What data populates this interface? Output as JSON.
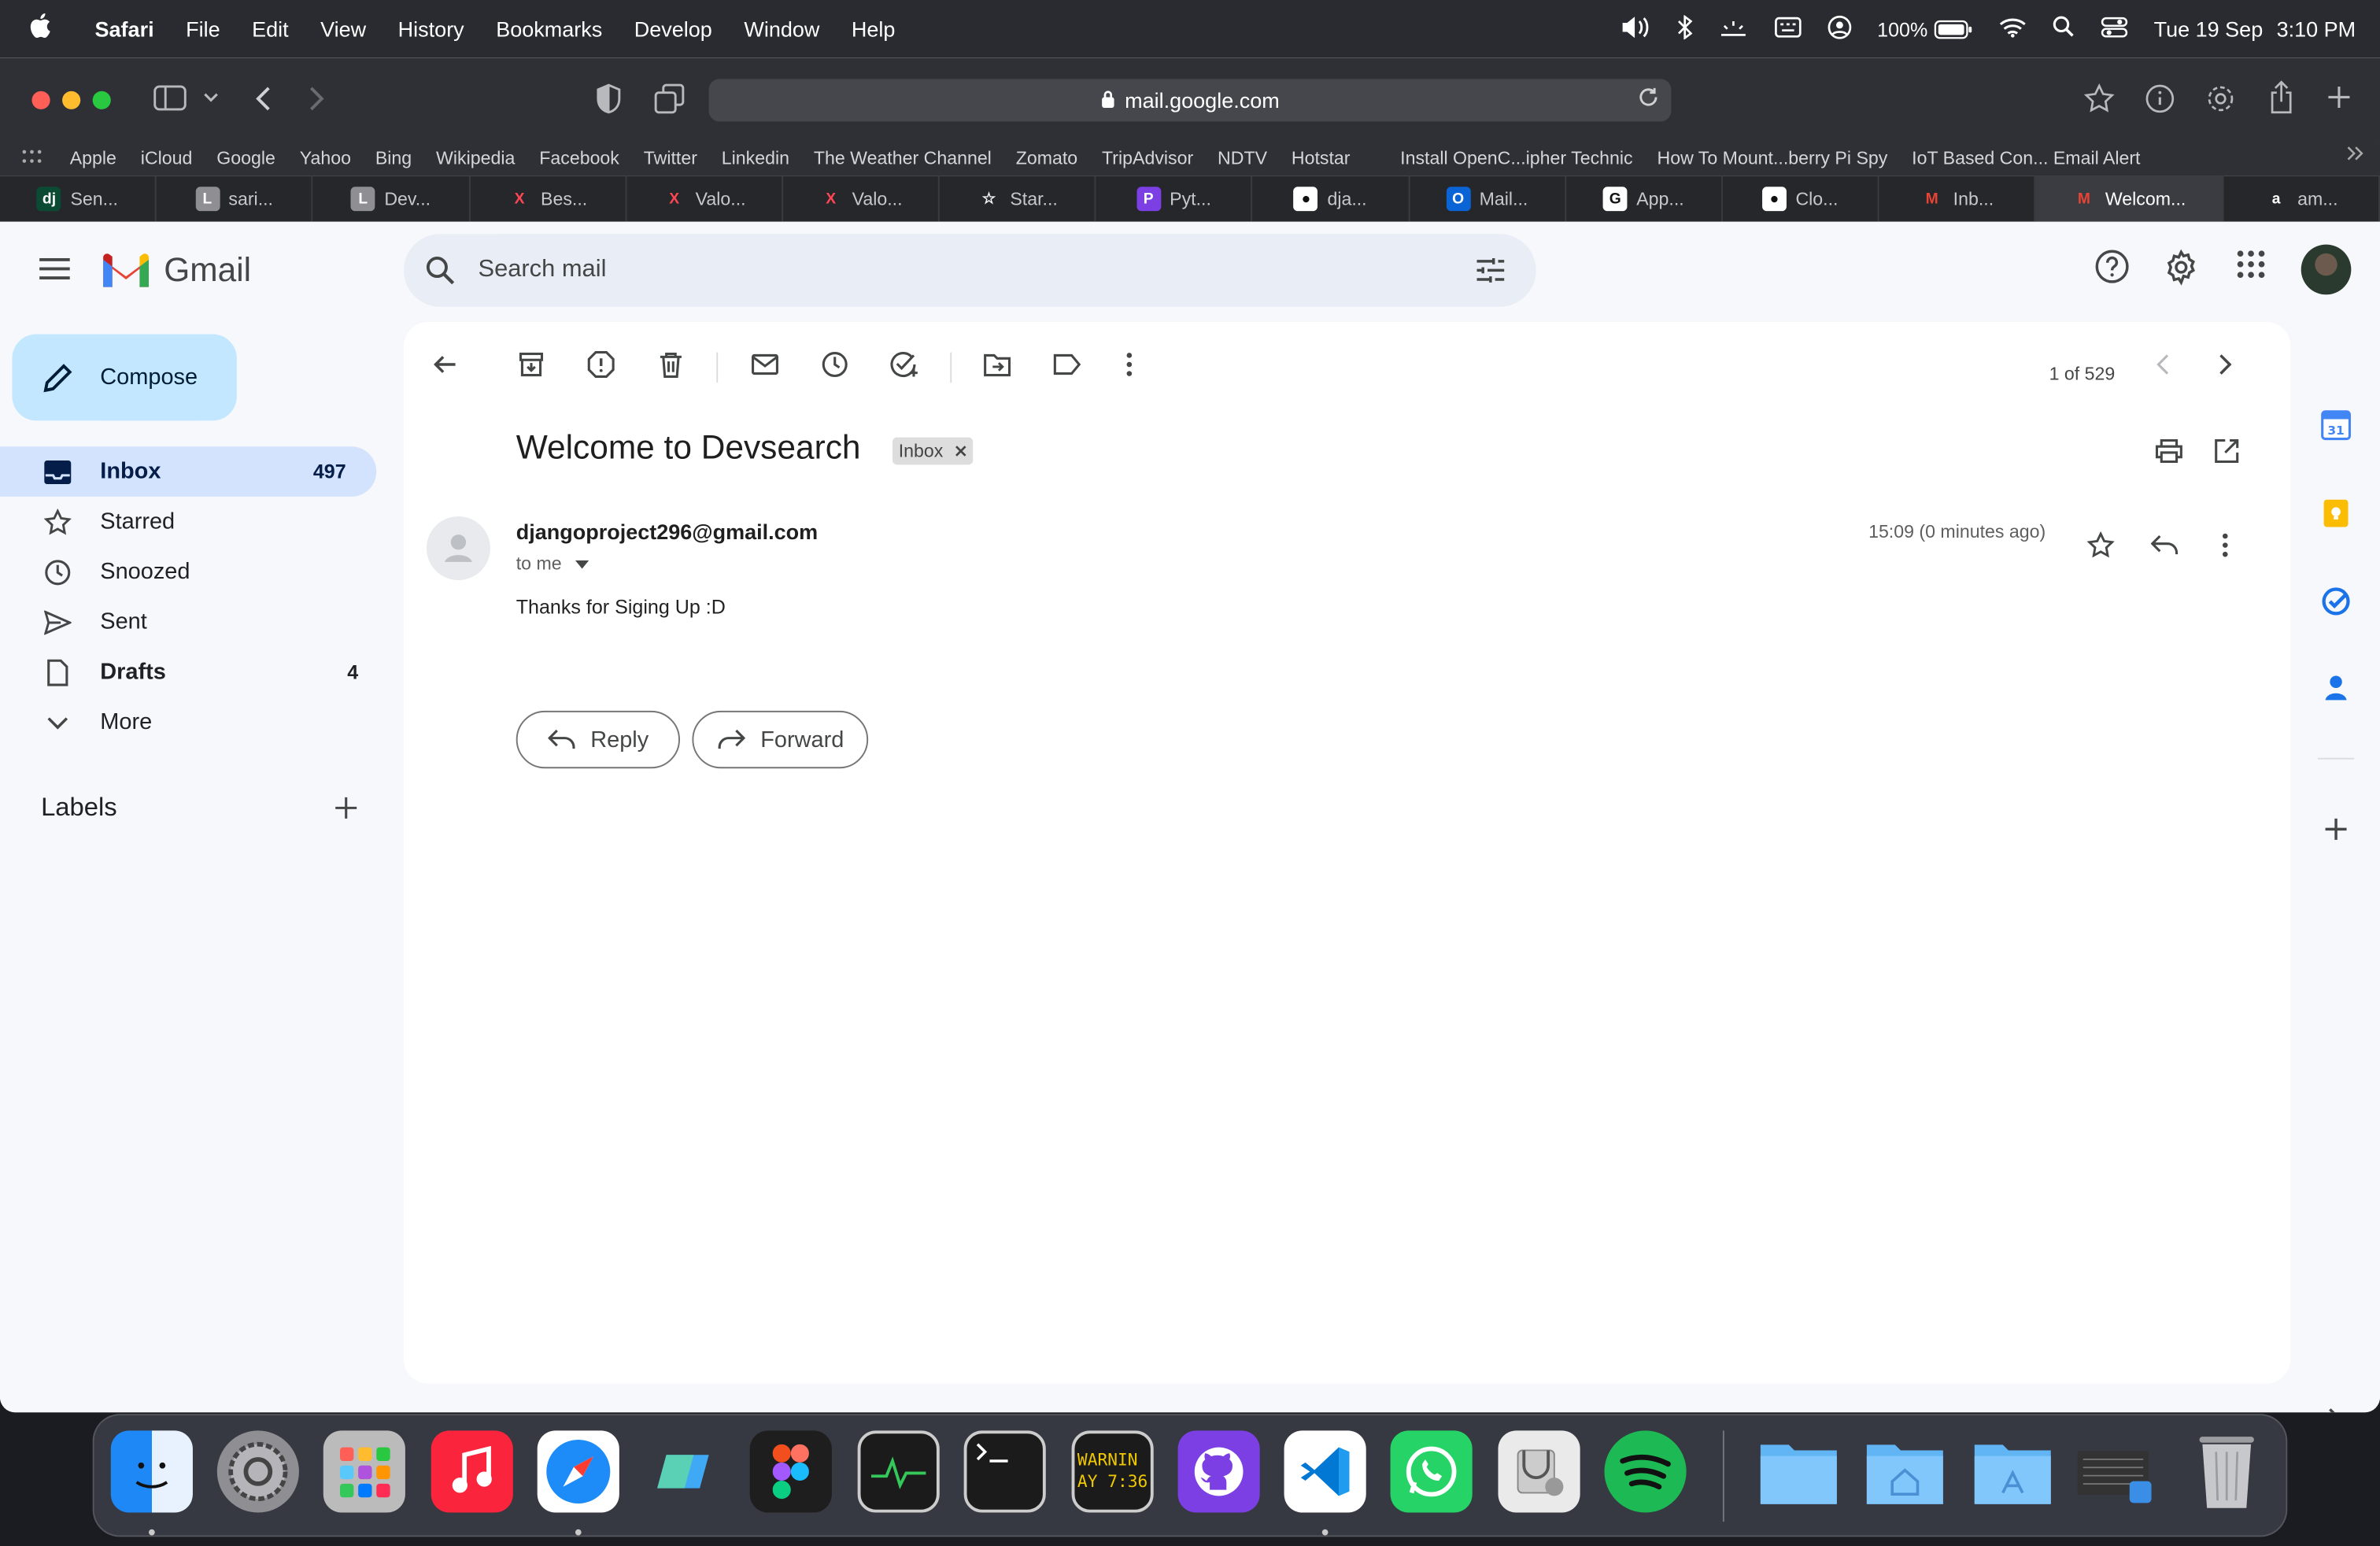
{
  "menubar": {
    "app": "Safari",
    "items": [
      "File",
      "Edit",
      "View",
      "History",
      "Bookmarks",
      "Develop",
      "Window",
      "Help"
    ],
    "battery": "100%",
    "date": "Tue 19 Sep",
    "time": "3:10 PM"
  },
  "browser": {
    "url": "mail.google.com",
    "favorites": [
      "Apple",
      "iCloud",
      "Google",
      "Yahoo",
      "Bing",
      "Wikipedia",
      "Facebook",
      "Twitter",
      "Linkedin",
      "The Weather Channel",
      "Zomato",
      "TripAdvisor",
      "NDTV",
      "Hotstar",
      "Install OpenC...ipher Technic",
      "How To Mount...berry Pi Spy",
      "IoT Based Con... Email Alert"
    ],
    "tabs": [
      {
        "label": "Sen...",
        "icon": "dj",
        "color": "#0c4b33"
      },
      {
        "label": "sari...",
        "icon": "L",
        "color": "#8e8e93"
      },
      {
        "label": "Dev...",
        "icon": "L",
        "color": "#8e8e93"
      },
      {
        "label": "Bes...",
        "icon": "X",
        "color": "#ff4655"
      },
      {
        "label": "Valo...",
        "icon": "X",
        "color": "#ff4655"
      },
      {
        "label": "Valo...",
        "icon": "X",
        "color": "#ff4655"
      },
      {
        "label": "Star...",
        "icon": "☆",
        "color": "transparent"
      },
      {
        "label": "Pyt...",
        "icon": "P",
        "color": "#7b3fe4"
      },
      {
        "label": "dja...",
        "icon": "●",
        "color": "#fff"
      },
      {
        "label": "Mail...",
        "icon": "O",
        "color": "#0a64d6"
      },
      {
        "label": "App...",
        "icon": "G",
        "color": "#fff"
      },
      {
        "label": "Clo...",
        "icon": "●",
        "color": "#fff"
      },
      {
        "label": "Inb...",
        "icon": "M",
        "color": "transparent"
      },
      {
        "label": "Welcom...",
        "icon": "M",
        "color": "transparent",
        "active": true
      },
      {
        "label": "am...",
        "icon": "a",
        "color": "transparent"
      }
    ]
  },
  "gmail": {
    "brand": "Gmail",
    "search_placeholder": "Search mail",
    "compose": "Compose",
    "nav": [
      {
        "label": "Inbox",
        "count": "497",
        "icon": "inbox-icon",
        "active": true
      },
      {
        "label": "Starred",
        "count": "",
        "icon": "star-icon"
      },
      {
        "label": "Snoozed",
        "count": "",
        "icon": "clock-icon"
      },
      {
        "label": "Sent",
        "count": "",
        "icon": "send-icon"
      },
      {
        "label": "Drafts",
        "count": "4",
        "icon": "draft-icon",
        "bold": true
      },
      {
        "label": "More",
        "count": "",
        "icon": "chevron-down-icon"
      }
    ],
    "labels_title": "Labels",
    "pager": "1 of 529",
    "message": {
      "subject": "Welcome to Devsearch",
      "chip": "Inbox",
      "sender": "djangoproject296@gmail.com",
      "to": "to me",
      "time": "15:09 (0 minutes ago)",
      "body": "Thanks for Siging Up :D",
      "reply": "Reply",
      "forward": "Forward"
    }
  },
  "dock": {
    "terminal_text": "WARNIN\nAY 7:36"
  }
}
